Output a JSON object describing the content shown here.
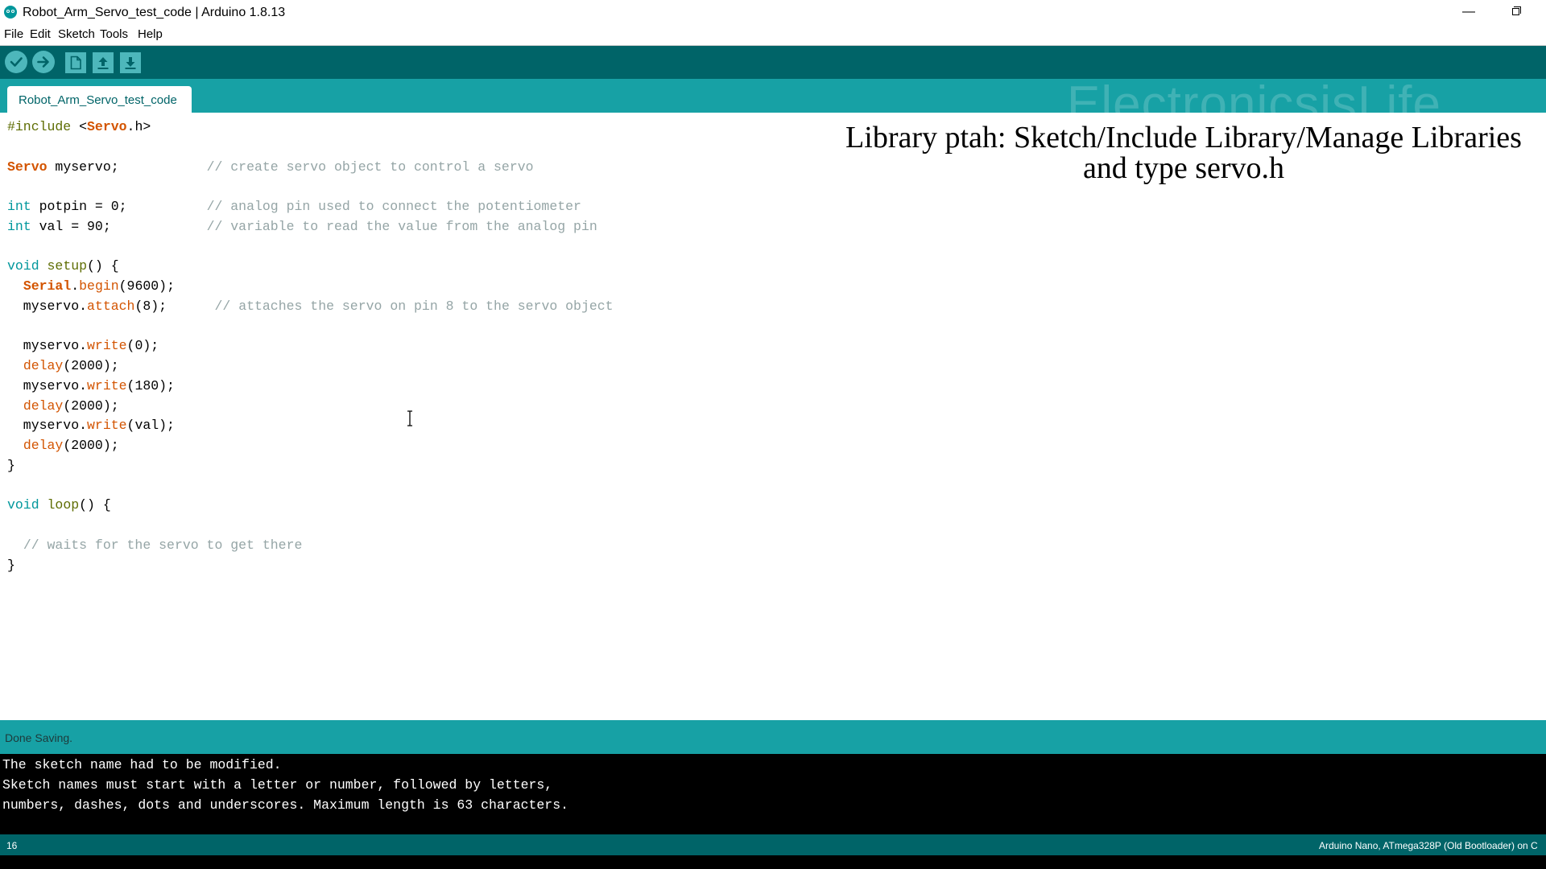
{
  "window": {
    "title": "Robot_Arm_Servo_test_code | Arduino 1.8.13",
    "minimize_glyph": "—"
  },
  "menu": [
    "File",
    "Edit",
    "Sketch",
    "Tools",
    "Help"
  ],
  "toolbar": {
    "buttons": [
      "verify-icon",
      "upload-icon",
      "new-icon",
      "open-icon",
      "save-icon"
    ],
    "colors": {
      "bar": "#006468",
      "button": "#4db7bb"
    }
  },
  "tab_area": {
    "watermark": "ElectronicsisLife",
    "active_tab": "Robot_Arm_Servo_test_code"
  },
  "editor": {
    "code_lines": [
      [
        {
          "t": "#include ",
          "c": "k-pre"
        },
        {
          "t": "<"
        },
        {
          "t": "Servo",
          "c": "k-class"
        },
        {
          "t": ".h>"
        }
      ],
      [],
      [
        {
          "t": "Servo",
          "c": "k-class"
        },
        {
          "t": " myservo;           "
        },
        {
          "t": "// create servo object to control a servo",
          "c": "k-cmt"
        }
      ],
      [],
      [
        {
          "t": "int",
          "c": "k-type"
        },
        {
          "t": " potpin = 0;          "
        },
        {
          "t": "// analog pin used to connect the potentiometer",
          "c": "k-cmt"
        }
      ],
      [
        {
          "t": "int",
          "c": "k-type"
        },
        {
          "t": " val = 90;            "
        },
        {
          "t": "// variable to read the value from the analog pin",
          "c": "k-cmt"
        }
      ],
      [],
      [
        {
          "t": "void",
          "c": "k-type"
        },
        {
          "t": " "
        },
        {
          "t": "setup",
          "c": "k-pre"
        },
        {
          "t": "() {"
        }
      ],
      [
        {
          "t": "  "
        },
        {
          "t": "Serial",
          "c": "k-class"
        },
        {
          "t": "."
        },
        {
          "t": "begin",
          "c": "k-func"
        },
        {
          "t": "(9600);"
        }
      ],
      [
        {
          "t": "  myservo."
        },
        {
          "t": "attach",
          "c": "k-func"
        },
        {
          "t": "(8);      "
        },
        {
          "t": "// attaches the servo on pin 8 to the servo object",
          "c": "k-cmt"
        }
      ],
      [],
      [
        {
          "t": "  myservo."
        },
        {
          "t": "write",
          "c": "k-func"
        },
        {
          "t": "(0);"
        }
      ],
      [
        {
          "t": "  "
        },
        {
          "t": "delay",
          "c": "k-func"
        },
        {
          "t": "(2000);"
        }
      ],
      [
        {
          "t": "  myservo."
        },
        {
          "t": "write",
          "c": "k-func"
        },
        {
          "t": "(180);"
        }
      ],
      [
        {
          "t": "  "
        },
        {
          "t": "delay",
          "c": "k-func"
        },
        {
          "t": "(2000);"
        }
      ],
      [
        {
          "t": "  myservo."
        },
        {
          "t": "write",
          "c": "k-func"
        },
        {
          "t": "(val);"
        }
      ],
      [
        {
          "t": "  "
        },
        {
          "t": "delay",
          "c": "k-func"
        },
        {
          "t": "(2000);"
        }
      ],
      [
        {
          "t": "}"
        }
      ],
      [],
      [
        {
          "t": "void",
          "c": "k-type"
        },
        {
          "t": " "
        },
        {
          "t": "loop",
          "c": "k-pre"
        },
        {
          "t": "() {"
        }
      ],
      [],
      [
        {
          "t": "  "
        },
        {
          "t": "// waits for the servo to get there",
          "c": "k-cmt"
        }
      ],
      [
        {
          "t": "}"
        }
      ]
    ],
    "overlay_caption": {
      "line1": "Library ptah: Sketch/Include Library/Manage Libraries",
      "line2": "and type servo.h"
    }
  },
  "status": {
    "message": "Done Saving."
  },
  "console": {
    "lines": [
      "The sketch name had to be modified.",
      "Sketch names must start with a letter or number, followed by letters,",
      "numbers, dashes, dots and underscores. Maximum length is 63 characters."
    ]
  },
  "footer": {
    "line_number": "16",
    "board": "Arduino Nano, ATmega328P (Old Bootloader) on C"
  }
}
